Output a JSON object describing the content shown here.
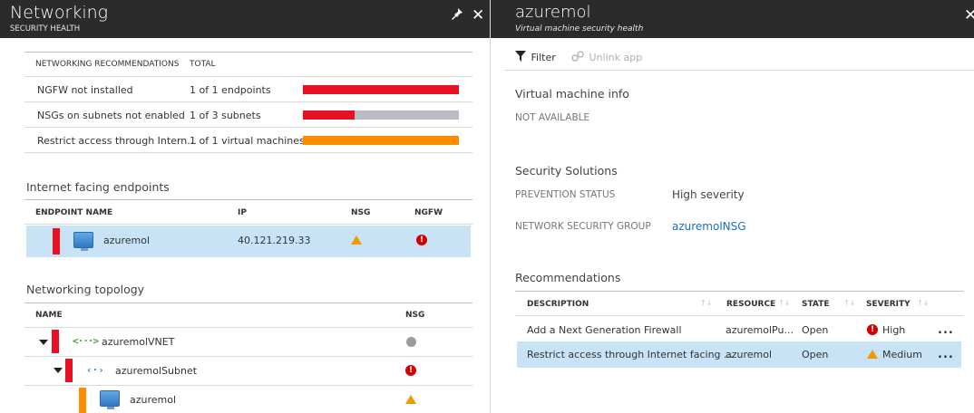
{
  "left_blade": {
    "title": "Networking",
    "subtitle": "SECURITY HEALTH",
    "pin_icon": "pin-icon",
    "close_icon": "close-icon",
    "recommendations": {
      "col_name": "NETWORKING RECOMMENDATIONS",
      "col_total": "TOTAL",
      "rows": [
        {
          "name": "NGFW not installed",
          "total": "1 of 1 endpoints",
          "fill": 1.0,
          "color": "#e81123"
        },
        {
          "name": "NSGs on subnets not enabled",
          "total": "1 of 3 subnets",
          "fill": 0.333,
          "color": "#e81123"
        },
        {
          "name": "Restrict access through Intern...",
          "total": "1 of 1 virtual machines",
          "fill": 1.0,
          "color": "#ff8c00"
        }
      ],
      "track_color": "#b9bcc4"
    },
    "endpoints": {
      "section_title": "Internet facing endpoints",
      "col_name": "ENDPOINT NAME",
      "col_ip": "IP",
      "col_nsg": "NSG",
      "col_ngfw": "NGFW",
      "row": {
        "name": "azuremol",
        "ip": "40.121.219.33",
        "nsg_icon": "warning-icon",
        "ngfw_icon": "error-icon"
      }
    },
    "topology": {
      "section_title": "Networking topology",
      "col_name": "NAME",
      "col_nsg": "NSG",
      "items": [
        {
          "name": "azuremolVNET",
          "icon": "vnet-icon",
          "nsg": "gray-dot-icon",
          "stripe": "#e81123"
        },
        {
          "name": "azuremolSubnet",
          "icon": "subnet-icon",
          "nsg": "error-icon",
          "stripe": "#e81123"
        },
        {
          "name": "azuremol",
          "icon": "vm-icon",
          "nsg": "warning-icon",
          "stripe": "#ff8c00"
        }
      ]
    }
  },
  "right_blade": {
    "title": "azuremol",
    "subtitle": "Virtual machine security health",
    "toolbar": {
      "filter_label": "Filter",
      "unlink_label": "Unlink app"
    },
    "vm_info": {
      "section_title": "Virtual machine info",
      "status": "NOT AVAILABLE"
    },
    "security_solutions": {
      "section_title": "Security Solutions",
      "prevention_label": "PREVENTION STATUS",
      "prevention_value": "High severity",
      "nsg_label": "NETWORK SECURITY GROUP",
      "nsg_value": "azuremolNSG"
    },
    "recommendations": {
      "section_title": "Recommendations",
      "col_description": "DESCRIPTION",
      "col_resource": "RESOURCE",
      "col_state": "STATE",
      "col_severity": "SEVERITY",
      "rows": [
        {
          "description": "Add a Next Generation Firewall",
          "resource": "azuremolPu...",
          "state": "Open",
          "severity": "High",
          "severity_icon": "error-icon",
          "more": "..."
        },
        {
          "description": "Restrict access through Internet facing ...",
          "resource": "azuremol",
          "state": "Open",
          "severity": "Medium",
          "severity_icon": "warning-icon",
          "more": "..."
        }
      ]
    }
  },
  "colors": {
    "header_bg": "#2b2b2b",
    "selected_row": "#c7e3f5",
    "link": "#1a6fc0",
    "error": "#d40000",
    "warning": "#f09a00"
  }
}
